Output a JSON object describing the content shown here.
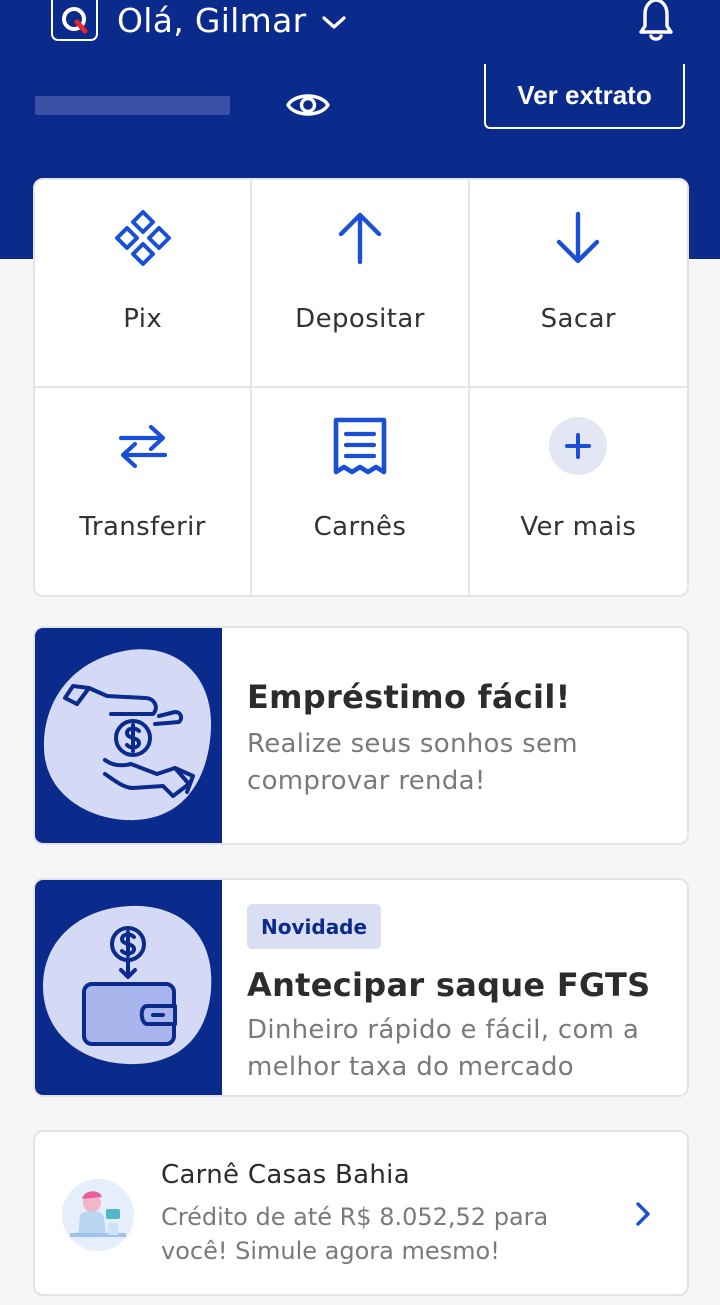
{
  "header": {
    "logo_letter": "Q",
    "greeting": "Olá, Gilmar",
    "statement_button": "Ver extrato"
  },
  "actions": [
    {
      "label": "Pix",
      "icon": "pix-icon"
    },
    {
      "label": "Depositar",
      "icon": "arrow-up-icon"
    },
    {
      "label": "Sacar",
      "icon": "arrow-down-icon"
    },
    {
      "label": "Transferir",
      "icon": "transfer-arrows-icon"
    },
    {
      "label": "Carnês",
      "icon": "receipt-icon"
    },
    {
      "label": "Ver mais",
      "icon": "plus-icon"
    }
  ],
  "promos": {
    "loan": {
      "title": "Empréstimo fácil!",
      "description": "Realize seus sonhos sem comprovar renda!",
      "icon": "hands-coin-icon"
    },
    "fgts": {
      "badge": "Novidade",
      "title": "Antecipar saque FGTS",
      "description": "Dinheiro rápido e fácil, com a melhor taxa do mercado",
      "icon": "wallet-coin-icon"
    }
  },
  "carne_offer": {
    "title": "Carnê Casas Bahia",
    "description": "Crédito de até R$ 8.052,52 para você! Simule agora mesmo!",
    "icon": "chevron-right-icon"
  },
  "colors": {
    "brand": "#0a2a8c",
    "accent": "#1a4fd6",
    "background": "#f6f6f7"
  }
}
